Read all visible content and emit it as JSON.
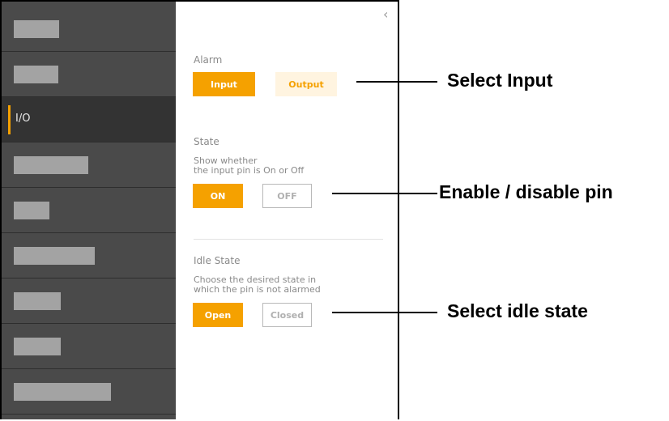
{
  "sidebar": {
    "active_label": "I/O"
  },
  "panel": {
    "alarm": {
      "title": "Alarm",
      "input_label": "Input",
      "output_label": "Output"
    },
    "state": {
      "title": "State",
      "description_line1": "Show whether",
      "description_line2": "the input pin is On or Off",
      "on_label": "ON",
      "off_label": "OFF"
    },
    "idle_state": {
      "title": "Idle State",
      "description_line1": "Choose the desired state in",
      "description_line2": "which the pin is not alarmed",
      "open_label": "Open",
      "closed_label": "Closed"
    }
  },
  "callouts": {
    "select_input": "Select Input",
    "enable_disable": "Enable / disable pin",
    "select_idle": "Select idle state"
  },
  "colors": {
    "accent": "#f5a100",
    "sidebar": "#4a4a4a",
    "sidebar_active": "#333333"
  },
  "icons": {
    "back": "chevron-left-icon"
  }
}
